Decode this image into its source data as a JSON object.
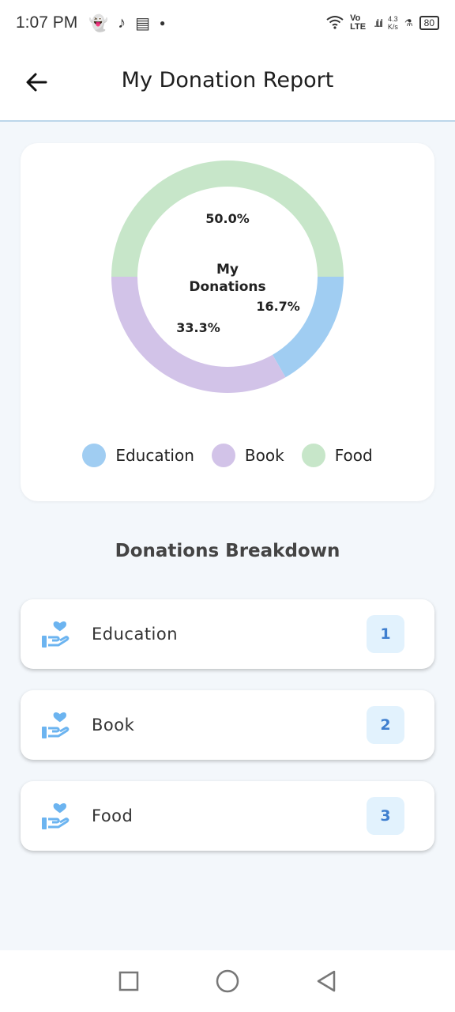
{
  "status": {
    "time": "1:07 PM",
    "network": "Vo LTE",
    "speed_value": "4.3",
    "speed_unit": "K/s",
    "battery": "80"
  },
  "app_bar": {
    "title": "My Donation Report"
  },
  "chart_data": {
    "type": "pie",
    "center_label_line1": "My",
    "center_label_line2": "Donations",
    "categories": [
      "Education",
      "Book",
      "Food"
    ],
    "values": [
      1,
      2,
      3
    ],
    "percent_labels": [
      "16.7%",
      "33.3%",
      "50.0%"
    ],
    "colors": [
      "#a0cdf2",
      "#d2c3e8",
      "#c7e6c9"
    ]
  },
  "legend": [
    {
      "label": "Education",
      "color": "#a0cdf2"
    },
    {
      "label": "Book",
      "color": "#d2c3e8"
    },
    {
      "label": "Food",
      "color": "#c7e6c9"
    }
  ],
  "breakdown": {
    "title": "Donations Breakdown",
    "items": [
      {
        "label": "Education",
        "count": "1",
        "icon": "donate-heart-icon"
      },
      {
        "label": "Book",
        "count": "2",
        "icon": "donate-heart-icon"
      },
      {
        "label": "Food",
        "count": "3",
        "icon": "donate-heart-icon"
      }
    ]
  },
  "colors": {
    "accent": "#3f7fcf",
    "count_bg": "#e2f2fd",
    "icon": "#6cb4f0"
  }
}
